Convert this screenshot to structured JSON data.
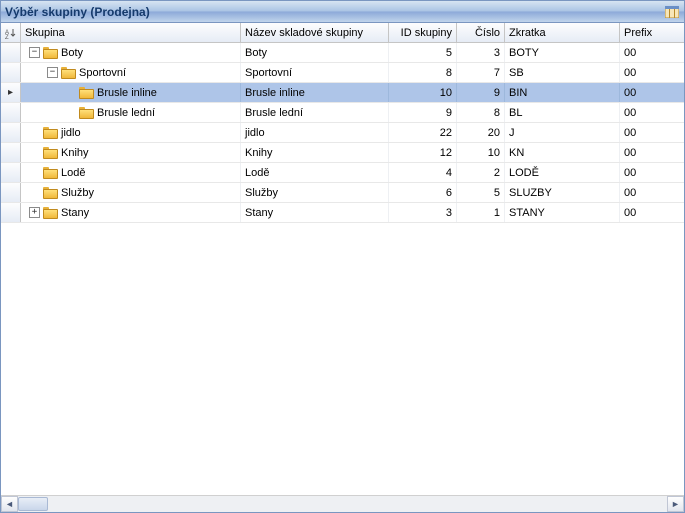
{
  "title": "Výběr skupiny (Prodejna)",
  "columns": {
    "tree": "Skupina",
    "name": "Název skladové skupiny",
    "id": "ID skupiny",
    "num": "Číslo",
    "abbr": "Zkratka",
    "prefix": "Prefix"
  },
  "rows": [
    {
      "indent": 0,
      "expander": "−",
      "label": "Boty",
      "name": "Boty",
      "id": "5",
      "num": "3",
      "abbr": "BOTY",
      "prefix": "00",
      "selected": false
    },
    {
      "indent": 1,
      "expander": "−",
      "label": "Sportovní",
      "name": "Sportovní",
      "id": "8",
      "num": "7",
      "abbr": "SB",
      "prefix": "00",
      "selected": false
    },
    {
      "indent": 2,
      "expander": "",
      "label": "Brusle inline",
      "name": "Brusle inline",
      "id": "10",
      "num": "9",
      "abbr": "BIN",
      "prefix": "00",
      "selected": true
    },
    {
      "indent": 2,
      "expander": "",
      "label": "Brusle lední",
      "name": "Brusle lední",
      "id": "9",
      "num": "8",
      "abbr": "BL",
      "prefix": "00",
      "selected": false
    },
    {
      "indent": 0,
      "expander": "",
      "label": "jidlo",
      "name": "jidlo",
      "id": "22",
      "num": "20",
      "abbr": "J",
      "prefix": "00",
      "selected": false
    },
    {
      "indent": 0,
      "expander": "",
      "label": "Knihy",
      "name": "Knihy",
      "id": "12",
      "num": "10",
      "abbr": "KN",
      "prefix": "00",
      "selected": false
    },
    {
      "indent": 0,
      "expander": "",
      "label": "Lodě",
      "name": "Lodě",
      "id": "4",
      "num": "2",
      "abbr": "LODĚ",
      "prefix": "00",
      "selected": false
    },
    {
      "indent": 0,
      "expander": "",
      "label": "Služby",
      "name": "Služby",
      "id": "6",
      "num": "5",
      "abbr": "SLUZBY",
      "prefix": "00",
      "selected": false
    },
    {
      "indent": 0,
      "expander": "+",
      "label": "Stany",
      "name": "Stany",
      "id": "3",
      "num": "1",
      "abbr": "STANY",
      "prefix": "00",
      "selected": false
    }
  ]
}
